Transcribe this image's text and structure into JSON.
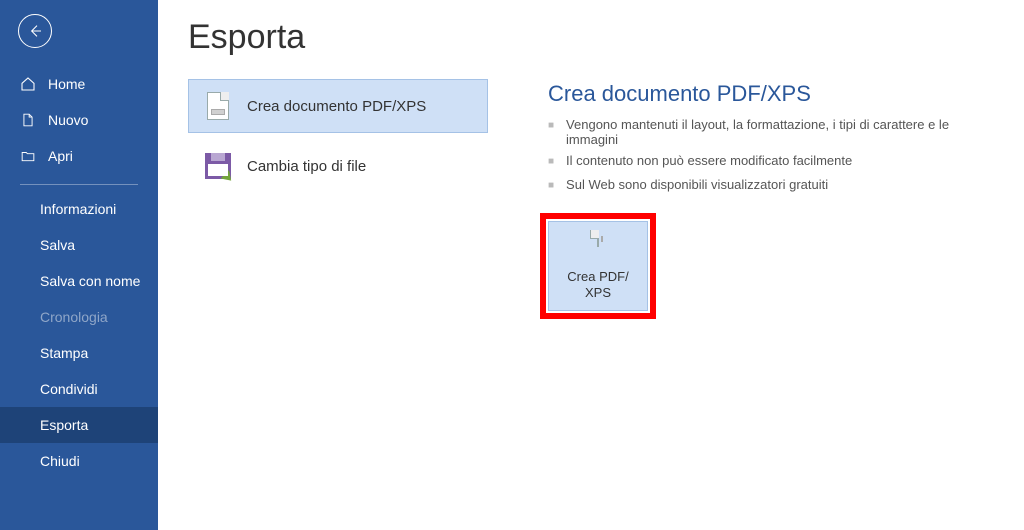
{
  "sidebar": {
    "items": [
      {
        "label": "Home"
      },
      {
        "label": "Nuovo"
      },
      {
        "label": "Apri"
      },
      {
        "label": "Informazioni"
      },
      {
        "label": "Salva"
      },
      {
        "label": "Salva con nome"
      },
      {
        "label": "Cronologia"
      },
      {
        "label": "Stampa"
      },
      {
        "label": "Condividi"
      },
      {
        "label": "Esporta"
      },
      {
        "label": "Chiudi"
      }
    ]
  },
  "main": {
    "title": "Esporta",
    "options": [
      {
        "label": "Crea documento PDF/XPS"
      },
      {
        "label": "Cambia tipo di file"
      }
    ],
    "section": {
      "title": "Crea documento PDF/XPS",
      "bullets": [
        "Vengono mantenuti il layout, la formattazione, i tipi di carattere e le immagini",
        "Il contenuto non può essere modificato facilmente",
        "Sul Web sono disponibili visualizzatori gratuiti"
      ],
      "action_label_line1": "Crea PDF/",
      "action_label_line2": "XPS"
    }
  },
  "colors": {
    "sidebar": "#2a579a",
    "selection": "#cfe0f6",
    "accent_text": "#2a579a",
    "highlight_border": "#ff0000"
  }
}
